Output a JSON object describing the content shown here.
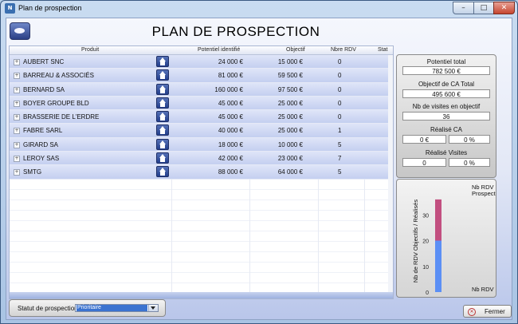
{
  "window": {
    "title": "Plan de prospection",
    "app_icon": "app-logo-icon"
  },
  "window_buttons": {
    "minimize": "–",
    "maximize": "□",
    "close": "✕"
  },
  "page_title": "PLAN DE PROSPECTION",
  "grid": {
    "headers": [
      "Produit",
      "Potentiel identifié",
      "Objectif",
      "Nbre RDV",
      "Stat"
    ],
    "expand_glyph": "+",
    "rows": [
      {
        "produit": "AUBERT SNC",
        "potentiel": "24 000 €",
        "objectif": "15 000 €",
        "rdv": "0"
      },
      {
        "produit": "BARREAU & ASSOCIÉS",
        "potentiel": "81 000 €",
        "objectif": "59 500 €",
        "rdv": "0"
      },
      {
        "produit": "BERNARD SA",
        "potentiel": "160 000 €",
        "objectif": "97 500 €",
        "rdv": "0"
      },
      {
        "produit": "BOYER GROUPE BLD",
        "potentiel": "45 000 €",
        "objectif": "25 000 €",
        "rdv": "0"
      },
      {
        "produit": "BRASSERIE DE L'ERDRE",
        "potentiel": "45 000 €",
        "objectif": "25 000 €",
        "rdv": "0"
      },
      {
        "produit": "FABRE SARL",
        "potentiel": "40 000 €",
        "objectif": "25 000 €",
        "rdv": "1"
      },
      {
        "produit": "GIRARD SA",
        "potentiel": "18 000 €",
        "objectif": "10 000 €",
        "rdv": "5"
      },
      {
        "produit": "LEROY SAS",
        "potentiel": "42 000 €",
        "objectif": "23 000 €",
        "rdv": "7"
      },
      {
        "produit": "SMTG",
        "potentiel": "88 000 €",
        "objectif": "64 000 €",
        "rdv": "5"
      }
    ]
  },
  "summary": {
    "potentiel_total_label": "Potentiel total",
    "potentiel_total": "782 500 €",
    "objectif_ca_label": "Objectif de CA Total",
    "objectif_ca": "495 600 €",
    "nb_visites_label": "Nb de visites en objectif",
    "nb_visites": "36",
    "realise_ca_label": "Réalisé CA",
    "realise_ca_value": "0 €",
    "realise_ca_pct": "0 %",
    "realise_visites_label": "Réalisé Visites",
    "realise_visites_value": "0",
    "realise_visites_pct": "0 %"
  },
  "chart_data": {
    "type": "bar",
    "ylabel": "Nb de RDV Objectifs / Réalisés",
    "ylim": [
      0,
      40
    ],
    "yticks": [
      "0",
      "5",
      "10",
      "15",
      "20",
      "25",
      "30",
      "35",
      "40"
    ],
    "series": [
      {
        "name": "Nb RDV Clients",
        "values": [
          20
        ],
        "color": "#5b8ff5"
      },
      {
        "name": "Nb RDV Prospects",
        "values": [
          16
        ],
        "color": "#c24f80"
      }
    ],
    "labels": {
      "prospects": "Nb RDV\nProspects",
      "clients": "Nb RDV Clients"
    }
  },
  "statut": {
    "label": "Statut de prospection",
    "value": "Prioritaire"
  },
  "close_button": {
    "label": "Fermer"
  }
}
